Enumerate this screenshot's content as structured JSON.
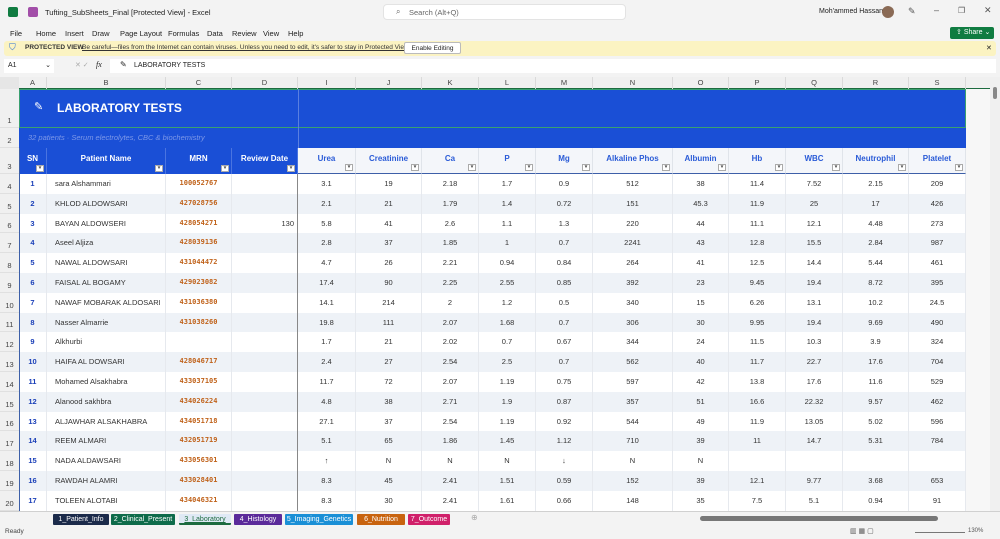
{
  "window": {
    "title": "Tufting_SubSheets_Final  [Protected View]  -  Excel",
    "search_placeholder": "Search (Alt+Q)",
    "user": "Moh'ammed Hassan",
    "share": "Share"
  },
  "menu": [
    "File",
    "Home",
    "Insert",
    "Draw",
    "Page Layout",
    "Formulas",
    "Data",
    "Review",
    "View",
    "Help"
  ],
  "protected_view": {
    "label": "PROTECTED VIEW",
    "message": "Be careful—files from the Internet can contain viruses. Unless you need to edit, it's safer to stay in Protected View.",
    "button": "Enable Editing"
  },
  "formula_bar": {
    "name_box": "A1",
    "fx": "fx",
    "content": "LABORATORY TESTS"
  },
  "columns": [
    "A",
    "B",
    "C",
    "D",
    "I",
    "J",
    "K",
    "L",
    "M",
    "N",
    "O",
    "P",
    "Q",
    "R",
    "S"
  ],
  "sheet": {
    "title": "LABORATORY TESTS",
    "subtitle": "32 patients  ·  Serum electrolytes, CBC & biochemistry",
    "headers": [
      "SN",
      "Patient Name",
      "MRN",
      "Review Date",
      "Urea",
      "Creatinine",
      "Ca",
      "P",
      "Mg",
      "Alkaline Phos",
      "Albumin",
      "Hb",
      "WBC",
      "Neutrophil",
      "Platelet"
    ],
    "row_numbers": [
      "1",
      "2",
      "3",
      "4",
      "5",
      "6",
      "7",
      "8",
      "9",
      "10",
      "11",
      "12",
      "13",
      "14",
      "15",
      "16",
      "17",
      "18",
      "19",
      "20"
    ],
    "rows": [
      [
        "1",
        "sara Alshammari",
        "100052767",
        "",
        "3.1",
        "19",
        "2.18",
        "1.7",
        "0.9",
        "512",
        "38",
        "11.4",
        "7.52",
        "2.15",
        "209"
      ],
      [
        "2",
        "KHLOD ALDOWSARI",
        "427028756",
        "",
        "2.1",
        "21",
        "1.79",
        "1.4",
        "0.72",
        "151",
        "45.3",
        "11.9",
        "25",
        "17",
        "426"
      ],
      [
        "3",
        "BAYAN ALDOWSERI",
        "428054271",
        "130",
        "5.8",
        "41",
        "2.6",
        "1.1",
        "1.3",
        "220",
        "44",
        "11.1",
        "12.1",
        "4.48",
        "273"
      ],
      [
        "4",
        "Aseel Aljiza",
        "428039136",
        "",
        "2.8",
        "37",
        "1.85",
        "1",
        "0.7",
        "2241",
        "43",
        "12.8",
        "15.5",
        "2.84",
        "987"
      ],
      [
        "5",
        "NAWAL ALDOWSARI",
        "431044472",
        "",
        "4.7",
        "26",
        "2.21",
        "0.94",
        "0.84",
        "264",
        "41",
        "12.5",
        "14.4",
        "5.44",
        "461"
      ],
      [
        "6",
        "FAISAL AL BOGAMY",
        "429023082",
        "",
        "17.4",
        "90",
        "2.25",
        "2.55",
        "0.85",
        "392",
        "23",
        "9.45",
        "19.4",
        "8.72",
        "395"
      ],
      [
        "7",
        "NAWAF MOBARAK ALDOSARI",
        "431036380",
        "",
        "14.1",
        "214",
        "2",
        "1.2",
        "0.5",
        "340",
        "15",
        "6.26",
        "13.1",
        "10.2",
        "24.5"
      ],
      [
        "8",
        "Nasser Almarrie",
        "431038260",
        "",
        "19.8",
        "111",
        "2.07",
        "1.68",
        "0.7",
        "306",
        "30",
        "9.95",
        "19.4",
        "9.69",
        "490"
      ],
      [
        "9",
        "Alkhurbi",
        "",
        "",
        "1.7",
        "21",
        "2.02",
        "0.7",
        "0.67",
        "344",
        "24",
        "11.5",
        "10.3",
        "3.9",
        "324"
      ],
      [
        "10",
        "HAIFA AL DOWSARI",
        "428046717",
        "",
        "2.4",
        "27",
        "2.54",
        "2.5",
        "0.7",
        "562",
        "40",
        "11.7",
        "22.7",
        "17.6",
        "704"
      ],
      [
        "11",
        "Mohamed Alsakhabra",
        "433037105",
        "",
        "11.7",
        "72",
        "2.07",
        "1.19",
        "0.75",
        "597",
        "42",
        "13.8",
        "17.6",
        "11.6",
        "529"
      ],
      [
        "12",
        "Alanood sakhbra",
        "434026224",
        "",
        "4.8",
        "38",
        "2.71",
        "1.9",
        "0.87",
        "357",
        "51",
        "16.6",
        "22.32",
        "9.57",
        "462"
      ],
      [
        "13",
        "ALJAWHAR ALSAKHABRA",
        "434051718",
        "",
        "27.1",
        "37",
        "2.54",
        "1.19",
        "0.92",
        "544",
        "49",
        "11.9",
        "13.05",
        "5.02",
        "596"
      ],
      [
        "14",
        "REEM ALMARI",
        "432051719",
        "",
        "5.1",
        "65",
        "1.86",
        "1.45",
        "1.12",
        "710",
        "39",
        "11",
        "14.7",
        "5.31",
        "784"
      ],
      [
        "15",
        "NADA ALDAWSARI",
        "433056301",
        "",
        "↑",
        "N",
        "N",
        "N",
        "↓",
        "N",
        "N",
        "",
        "",
        "",
        ""
      ],
      [
        "16",
        "RAWDAH ALAMRI",
        "433028401",
        "",
        "8.3",
        "45",
        "2.41",
        "1.51",
        "0.59",
        "152",
        "39",
        "12.1",
        "9.77",
        "3.68",
        "653"
      ],
      [
        "17",
        "TOLEEN ALOTABI",
        "434046321",
        "",
        "8.3",
        "30",
        "2.41",
        "1.61",
        "0.66",
        "148",
        "35",
        "7.5",
        "5.1",
        "0.94",
        "91"
      ]
    ]
  },
  "tabs": [
    {
      "label": "1_Patient_Info",
      "color": "#1b2a4a"
    },
    {
      "label": "2_Clinical_Present",
      "color": "#0e6b4a"
    },
    {
      "label": "3_Laboratory",
      "color": "#dfe9f5"
    },
    {
      "label": "4_Histology",
      "color": "#5b2a9a"
    },
    {
      "label": "5_Imaging_Genetics",
      "color": "#1a8fd6"
    },
    {
      "label": "6_Nutrition",
      "color": "#c8630f"
    },
    {
      "label": "7_Outcome",
      "color": "#d0206a"
    }
  ],
  "status": {
    "text": "Ready",
    "zoom": "130%"
  },
  "colors": {
    "header_blue": "#1a4fd6",
    "mrn": "#c0621a",
    "sn": "#1a3fb8",
    "header_text": "#2a5bd7"
  }
}
